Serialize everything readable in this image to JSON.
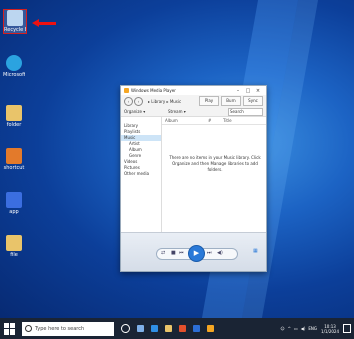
{
  "desktop": {
    "icons": [
      {
        "label": "Recycle Bin",
        "color": "#bcd6f0"
      },
      {
        "label": "Microsoft Edge",
        "color": "#2ba3e0"
      },
      {
        "label": "folder",
        "color": "#e9c46a"
      },
      {
        "label": "shortcut",
        "color": "#e37a2b"
      },
      {
        "label": "app",
        "color": "#3b6ee0"
      },
      {
        "label": "file",
        "color": "#e9c46a"
      }
    ]
  },
  "window": {
    "title": "Windows Media Player",
    "breadcrumb": "▸ Library ▸ Music",
    "tabs": [
      "Play",
      "Burn",
      "Sync"
    ],
    "toolbar": {
      "organize": "Organize ▾",
      "stream": "Stream ▾",
      "search_placeholder": "Search"
    },
    "nav_items": [
      {
        "label": "Library",
        "sub": false,
        "hi": false
      },
      {
        "label": "Playlists",
        "sub": false,
        "hi": false
      },
      {
        "label": "Music",
        "sub": false,
        "hi": true
      },
      {
        "label": "Artist",
        "sub": true,
        "hi": false
      },
      {
        "label": "Album",
        "sub": true,
        "hi": false
      },
      {
        "label": "Genre",
        "sub": true,
        "hi": false
      },
      {
        "label": "Videos",
        "sub": false,
        "hi": false
      },
      {
        "label": "Pictures",
        "sub": false,
        "hi": false
      },
      {
        "label": "Other media",
        "sub": false,
        "hi": false
      }
    ],
    "columns": [
      "Album",
      "#",
      "Title"
    ],
    "empty_message": "There are no items in your Music library. Click Organize and then Manage libraries to add folders."
  },
  "taskbar": {
    "search_placeholder": "Type here to search",
    "time": "10:13",
    "date": "1/1/2024"
  }
}
